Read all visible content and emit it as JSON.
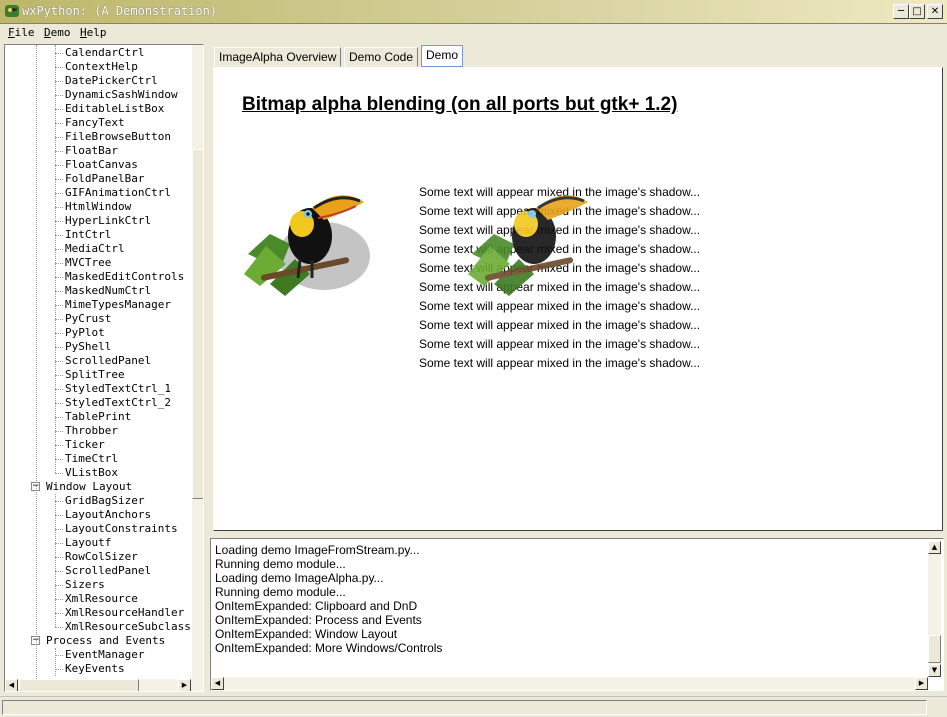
{
  "window": {
    "title": "wxPython: (A Demonstration)"
  },
  "menu": [
    {
      "key": "F",
      "rest": "ile"
    },
    {
      "key": "D",
      "rest": "emo"
    },
    {
      "key": "H",
      "rest": "elp"
    }
  ],
  "tree": {
    "items_more": [
      "CalendarCtrl",
      "ContextHelp",
      "DatePickerCtrl",
      "DynamicSashWindow",
      "EditableListBox",
      "FancyText",
      "FileBrowseButton",
      "FloatBar",
      "FloatCanvas",
      "FoldPanelBar",
      "GIFAnimationCtrl",
      "HtmlWindow",
      "HyperLinkCtrl",
      "IntCtrl",
      "MediaCtrl",
      "MVCTree",
      "MaskedEditControls",
      "MaskedNumCtrl",
      "MimeTypesManager",
      "PyCrust",
      "PyPlot",
      "PyShell",
      "ScrolledPanel",
      "SplitTree",
      "StyledTextCtrl_1",
      "StyledTextCtrl_2",
      "TablePrint",
      "Throbber",
      "Ticker",
      "TimeCtrl",
      "VListBox"
    ],
    "group_layout": "Window Layout",
    "items_layout": [
      "GridBagSizer",
      "LayoutAnchors",
      "LayoutConstraints",
      "Layoutf",
      "RowColSizer",
      "ScrolledPanel",
      "Sizers",
      "XmlResource",
      "XmlResourceHandler",
      "XmlResourceSubclass"
    ],
    "group_events": "Process and Events",
    "items_events": [
      "EventManager",
      "KeyEvents"
    ]
  },
  "tabs": [
    "ImageAlpha Overview",
    "Demo Code",
    "Demo"
  ],
  "active_tab": 2,
  "demo": {
    "title": "Bitmap alpha blending (on all ports but gtk+ 1.2)",
    "shadow_text": "Some text will appear mixed in the image's shadow...",
    "shadow_text_count": 10
  },
  "log": [
    "Loading demo ImageFromStream.py...",
    "Running demo module...",
    "Loading demo ImageAlpha.py...",
    "Running demo module...",
    "OnItemExpanded: Clipboard and DnD",
    "OnItemExpanded: Process and Events",
    "OnItemExpanded: Window Layout",
    "OnItemExpanded: More Windows/Controls"
  ],
  "colors": {
    "titlebar": "#bdb76b",
    "face": "#ece9d8",
    "active_tab_border": "#7a96df"
  },
  "icons": [
    "app-icon",
    "minimize-icon",
    "maximize-icon",
    "close-icon",
    "toucan-image",
    "scroll-up-icon",
    "scroll-down-icon",
    "scroll-left-icon",
    "scroll-right-icon",
    "expander-minus-icon"
  ]
}
